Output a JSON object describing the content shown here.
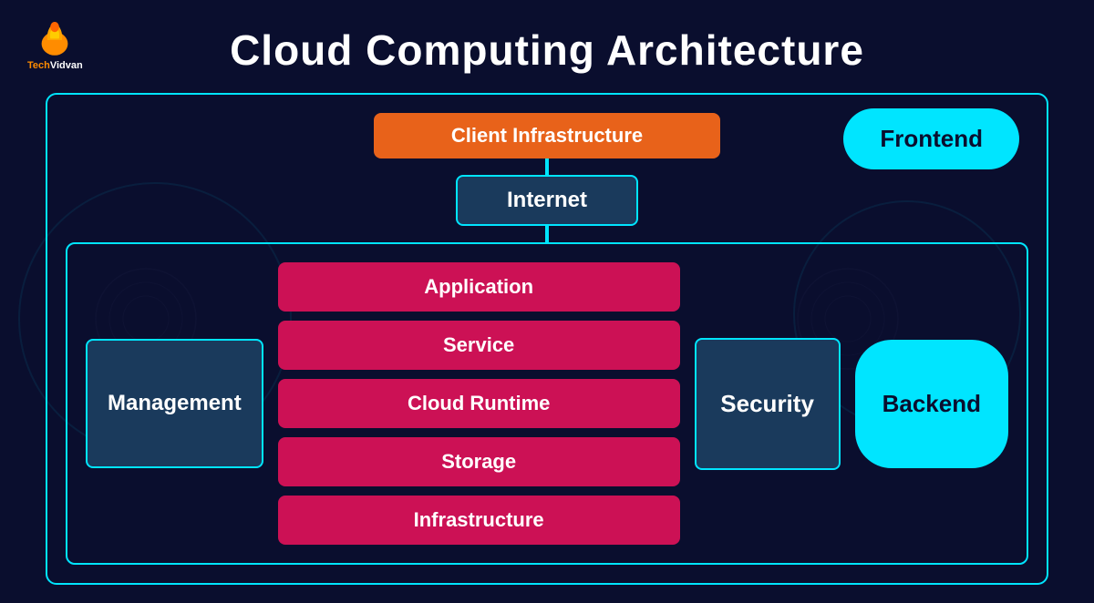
{
  "title": "Cloud Computing Architecture",
  "logo": {
    "text_orange": "Tech",
    "text_white": "Vidvan"
  },
  "nodes": {
    "client_infrastructure": "Client Infrastructure",
    "frontend": "Frontend",
    "internet": "Internet",
    "management": "Management",
    "security": "Security",
    "backend": "Backend"
  },
  "layers": [
    "Application",
    "Service",
    "Cloud Runtime",
    "Storage",
    "Infrastructure"
  ],
  "colors": {
    "bg": "#0a0e2e",
    "accent": "#00e5ff",
    "orange": "#e8621a",
    "pink": "#cc1155",
    "dark_blue": "#1a3a5c"
  }
}
